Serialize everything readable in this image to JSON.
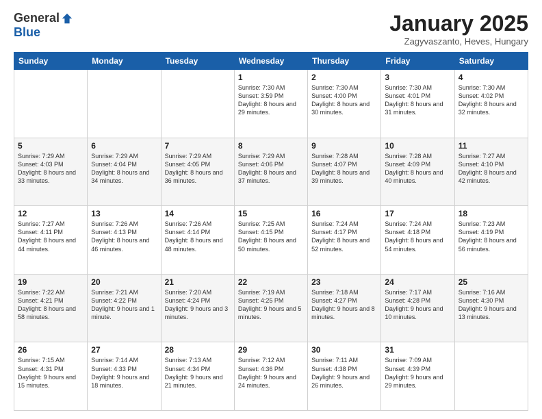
{
  "logo": {
    "general": "General",
    "blue": "Blue"
  },
  "header": {
    "title": "January 2025",
    "subtitle": "Zagyvaszanto, Heves, Hungary"
  },
  "weekdays": [
    "Sunday",
    "Monday",
    "Tuesday",
    "Wednesday",
    "Thursday",
    "Friday",
    "Saturday"
  ],
  "weeks": [
    [
      {
        "day": "",
        "info": ""
      },
      {
        "day": "",
        "info": ""
      },
      {
        "day": "",
        "info": ""
      },
      {
        "day": "1",
        "info": "Sunrise: 7:30 AM\nSunset: 3:59 PM\nDaylight: 8 hours and 29 minutes."
      },
      {
        "day": "2",
        "info": "Sunrise: 7:30 AM\nSunset: 4:00 PM\nDaylight: 8 hours and 30 minutes."
      },
      {
        "day": "3",
        "info": "Sunrise: 7:30 AM\nSunset: 4:01 PM\nDaylight: 8 hours and 31 minutes."
      },
      {
        "day": "4",
        "info": "Sunrise: 7:30 AM\nSunset: 4:02 PM\nDaylight: 8 hours and 32 minutes."
      }
    ],
    [
      {
        "day": "5",
        "info": "Sunrise: 7:29 AM\nSunset: 4:03 PM\nDaylight: 8 hours and 33 minutes."
      },
      {
        "day": "6",
        "info": "Sunrise: 7:29 AM\nSunset: 4:04 PM\nDaylight: 8 hours and 34 minutes."
      },
      {
        "day": "7",
        "info": "Sunrise: 7:29 AM\nSunset: 4:05 PM\nDaylight: 8 hours and 36 minutes."
      },
      {
        "day": "8",
        "info": "Sunrise: 7:29 AM\nSunset: 4:06 PM\nDaylight: 8 hours and 37 minutes."
      },
      {
        "day": "9",
        "info": "Sunrise: 7:28 AM\nSunset: 4:07 PM\nDaylight: 8 hours and 39 minutes."
      },
      {
        "day": "10",
        "info": "Sunrise: 7:28 AM\nSunset: 4:09 PM\nDaylight: 8 hours and 40 minutes."
      },
      {
        "day": "11",
        "info": "Sunrise: 7:27 AM\nSunset: 4:10 PM\nDaylight: 8 hours and 42 minutes."
      }
    ],
    [
      {
        "day": "12",
        "info": "Sunrise: 7:27 AM\nSunset: 4:11 PM\nDaylight: 8 hours and 44 minutes."
      },
      {
        "day": "13",
        "info": "Sunrise: 7:26 AM\nSunset: 4:13 PM\nDaylight: 8 hours and 46 minutes."
      },
      {
        "day": "14",
        "info": "Sunrise: 7:26 AM\nSunset: 4:14 PM\nDaylight: 8 hours and 48 minutes."
      },
      {
        "day": "15",
        "info": "Sunrise: 7:25 AM\nSunset: 4:15 PM\nDaylight: 8 hours and 50 minutes."
      },
      {
        "day": "16",
        "info": "Sunrise: 7:24 AM\nSunset: 4:17 PM\nDaylight: 8 hours and 52 minutes."
      },
      {
        "day": "17",
        "info": "Sunrise: 7:24 AM\nSunset: 4:18 PM\nDaylight: 8 hours and 54 minutes."
      },
      {
        "day": "18",
        "info": "Sunrise: 7:23 AM\nSunset: 4:19 PM\nDaylight: 8 hours and 56 minutes."
      }
    ],
    [
      {
        "day": "19",
        "info": "Sunrise: 7:22 AM\nSunset: 4:21 PM\nDaylight: 8 hours and 58 minutes."
      },
      {
        "day": "20",
        "info": "Sunrise: 7:21 AM\nSunset: 4:22 PM\nDaylight: 9 hours and 1 minute."
      },
      {
        "day": "21",
        "info": "Sunrise: 7:20 AM\nSunset: 4:24 PM\nDaylight: 9 hours and 3 minutes."
      },
      {
        "day": "22",
        "info": "Sunrise: 7:19 AM\nSunset: 4:25 PM\nDaylight: 9 hours and 5 minutes."
      },
      {
        "day": "23",
        "info": "Sunrise: 7:18 AM\nSunset: 4:27 PM\nDaylight: 9 hours and 8 minutes."
      },
      {
        "day": "24",
        "info": "Sunrise: 7:17 AM\nSunset: 4:28 PM\nDaylight: 9 hours and 10 minutes."
      },
      {
        "day": "25",
        "info": "Sunrise: 7:16 AM\nSunset: 4:30 PM\nDaylight: 9 hours and 13 minutes."
      }
    ],
    [
      {
        "day": "26",
        "info": "Sunrise: 7:15 AM\nSunset: 4:31 PM\nDaylight: 9 hours and 15 minutes."
      },
      {
        "day": "27",
        "info": "Sunrise: 7:14 AM\nSunset: 4:33 PM\nDaylight: 9 hours and 18 minutes."
      },
      {
        "day": "28",
        "info": "Sunrise: 7:13 AM\nSunset: 4:34 PM\nDaylight: 9 hours and 21 minutes."
      },
      {
        "day": "29",
        "info": "Sunrise: 7:12 AM\nSunset: 4:36 PM\nDaylight: 9 hours and 24 minutes."
      },
      {
        "day": "30",
        "info": "Sunrise: 7:11 AM\nSunset: 4:38 PM\nDaylight: 9 hours and 26 minutes."
      },
      {
        "day": "31",
        "info": "Sunrise: 7:09 AM\nSunset: 4:39 PM\nDaylight: 9 hours and 29 minutes."
      },
      {
        "day": "",
        "info": ""
      }
    ]
  ]
}
